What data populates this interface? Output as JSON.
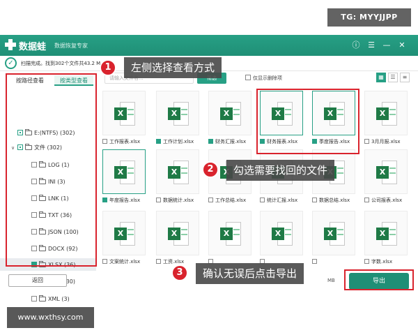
{
  "watermark_top": "TG: MYYJJPP",
  "watermark_bottom": "www.wxthsy.com",
  "app": {
    "name": "数据蛙",
    "subtitle": "数据恢复专家",
    "controls": [
      "ⓘ",
      "☰",
      "—",
      "✕"
    ]
  },
  "scan_status": "扫描完成。找到302个文件共43.2 M",
  "search": {
    "placeholder": "请输入文件名..."
  },
  "toolbar": {
    "filter_label": "筛选",
    "show_deleted_label": "仅显示删除项"
  },
  "view_icons": [
    "▦",
    "☰",
    "≡"
  ],
  "sidebar": {
    "tab_path": "按路径查看",
    "tab_type": "按类型查看",
    "tree": [
      {
        "label": "E:(NTFS) (302)",
        "level": 0,
        "arrow": "",
        "state": "part"
      },
      {
        "label": "文件 (302)",
        "level": 1,
        "arrow": "∨",
        "state": "part"
      },
      {
        "label": "LOG (1)",
        "level": 2,
        "arrow": "",
        "state": "off"
      },
      {
        "label": "INI (3)",
        "level": 2,
        "arrow": "",
        "state": "off"
      },
      {
        "label": "LNK (1)",
        "level": 2,
        "arrow": "",
        "state": "off"
      },
      {
        "label": "TXT (36)",
        "level": 2,
        "arrow": "",
        "state": "off"
      },
      {
        "label": "JSON (100)",
        "level": 2,
        "arrow": "",
        "state": "off"
      },
      {
        "label": "DOCX (92)",
        "level": 2,
        "arrow": "",
        "state": "off"
      },
      {
        "label": "XLSX (36)",
        "level": 2,
        "arrow": "",
        "state": "on"
      },
      {
        "label": "PPTX (30)",
        "level": 2,
        "arrow": "",
        "state": "off"
      },
      {
        "label": "XML (3)",
        "level": 2,
        "arrow": "",
        "state": "off"
      }
    ]
  },
  "files": [
    {
      "name": "工作报表.xlsx",
      "checked": false
    },
    {
      "name": "工作计划.xlsx",
      "checked": true
    },
    {
      "name": "财务汇报.xlsx",
      "checked": true
    },
    {
      "name": "财务报表.xlsx",
      "checked": true
    },
    {
      "name": "季度报告.xlsx",
      "checked": true
    },
    {
      "name": "3月月报.xlsx",
      "checked": false
    },
    {
      "name": "年度报告.xlsx",
      "checked": true
    },
    {
      "name": "数据统计.xlsx",
      "checked": false
    },
    {
      "name": "工作总结.xlsx",
      "checked": false
    },
    {
      "name": "统计汇报.xlsx",
      "checked": false
    },
    {
      "name": "数据总结.xlsx",
      "checked": false
    },
    {
      "name": "公司报表.xlsx",
      "checked": false
    },
    {
      "name": "文案统计.xlsx",
      "checked": false
    },
    {
      "name": "工资.xlsx",
      "checked": false
    },
    {
      "name": "",
      "checked": false
    },
    {
      "name": "",
      "checked": false
    },
    {
      "name": "",
      "checked": false
    },
    {
      "name": "字数.xlsx",
      "checked": false
    }
  ],
  "selected_size": "MB",
  "buttons": {
    "back": "返回",
    "export": "导出"
  },
  "steps": [
    {
      "num": "1",
      "text": "左侧选择查看方式"
    },
    {
      "num": "2",
      "text": "勾选需要找回的文件"
    },
    {
      "num": "3",
      "text": "确认无误后点击导出"
    }
  ],
  "colors": {
    "brand": "#1f8f76",
    "highlight": "#d9232d"
  }
}
